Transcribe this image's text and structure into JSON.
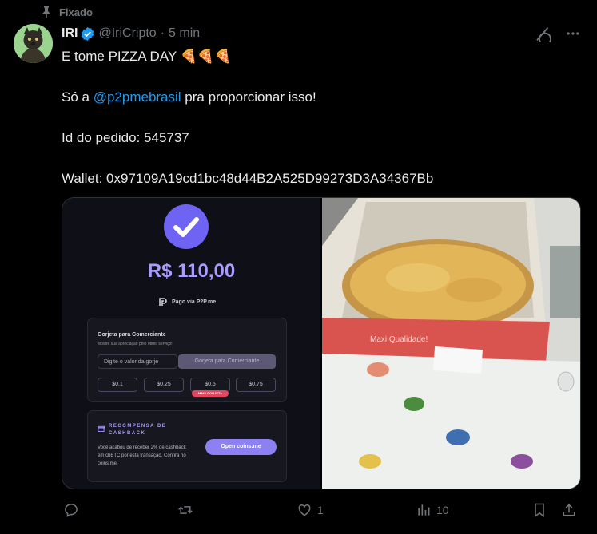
{
  "pinned": {
    "label": "Fixado"
  },
  "author": {
    "name": "IRI",
    "handle": "@IriCripto",
    "separator": "·",
    "time": "5 min"
  },
  "post": {
    "line1": "E tome PIZZA DAY 🍕🍕🍕",
    "line2_prefix": "Só a ",
    "line2_mention": "@p2pmebrasil",
    "line2_suffix": " pra proporcionar isso!",
    "line3": "Id do pedido: 545737",
    "line4": "Wallet: 0x97109A19cd1bc48d44B2A525D99273D3A34367Bb"
  },
  "receipt": {
    "amount": "R$ 110,00",
    "paid_via": "Pago via P2P.me",
    "tip_title": "Gorjeta para Comerciante",
    "tip_subtitle": "Mostre sua apreciação pelo ótimo serviço!",
    "tip_input_placeholder": "Digite o valor da gorje",
    "tip_button": "Gorjeta para Comerciante",
    "tip_options": [
      "$0.1",
      "$0.25",
      "$0.5",
      "$0.75"
    ],
    "tip_badge": "MAIS GORJETA",
    "cashback_title": "RECOMPENSA DE CASHBACK",
    "cashback_text": "Você acabou de receber 2% de cashback em cbBTC por esta transação. Confira no coins.me.",
    "cashback_button": "Open coins.me"
  },
  "photo": {
    "box_print": "Maxi Qualidade!"
  },
  "actions": {
    "replies": "",
    "reposts": "",
    "likes": "1",
    "views": "10"
  },
  "colors": {
    "accent": "#1d9bf0",
    "muted": "#71767b",
    "receipt_accent": "#a99bff"
  },
  "icons": [
    "pin-icon",
    "verified-badge-icon",
    "grok-icon",
    "more-icon",
    "checkmark-icon",
    "p2p-logo-icon",
    "gift-icon",
    "reply-icon",
    "repost-icon",
    "like-icon",
    "views-icon",
    "bookmark-icon",
    "share-icon"
  ]
}
